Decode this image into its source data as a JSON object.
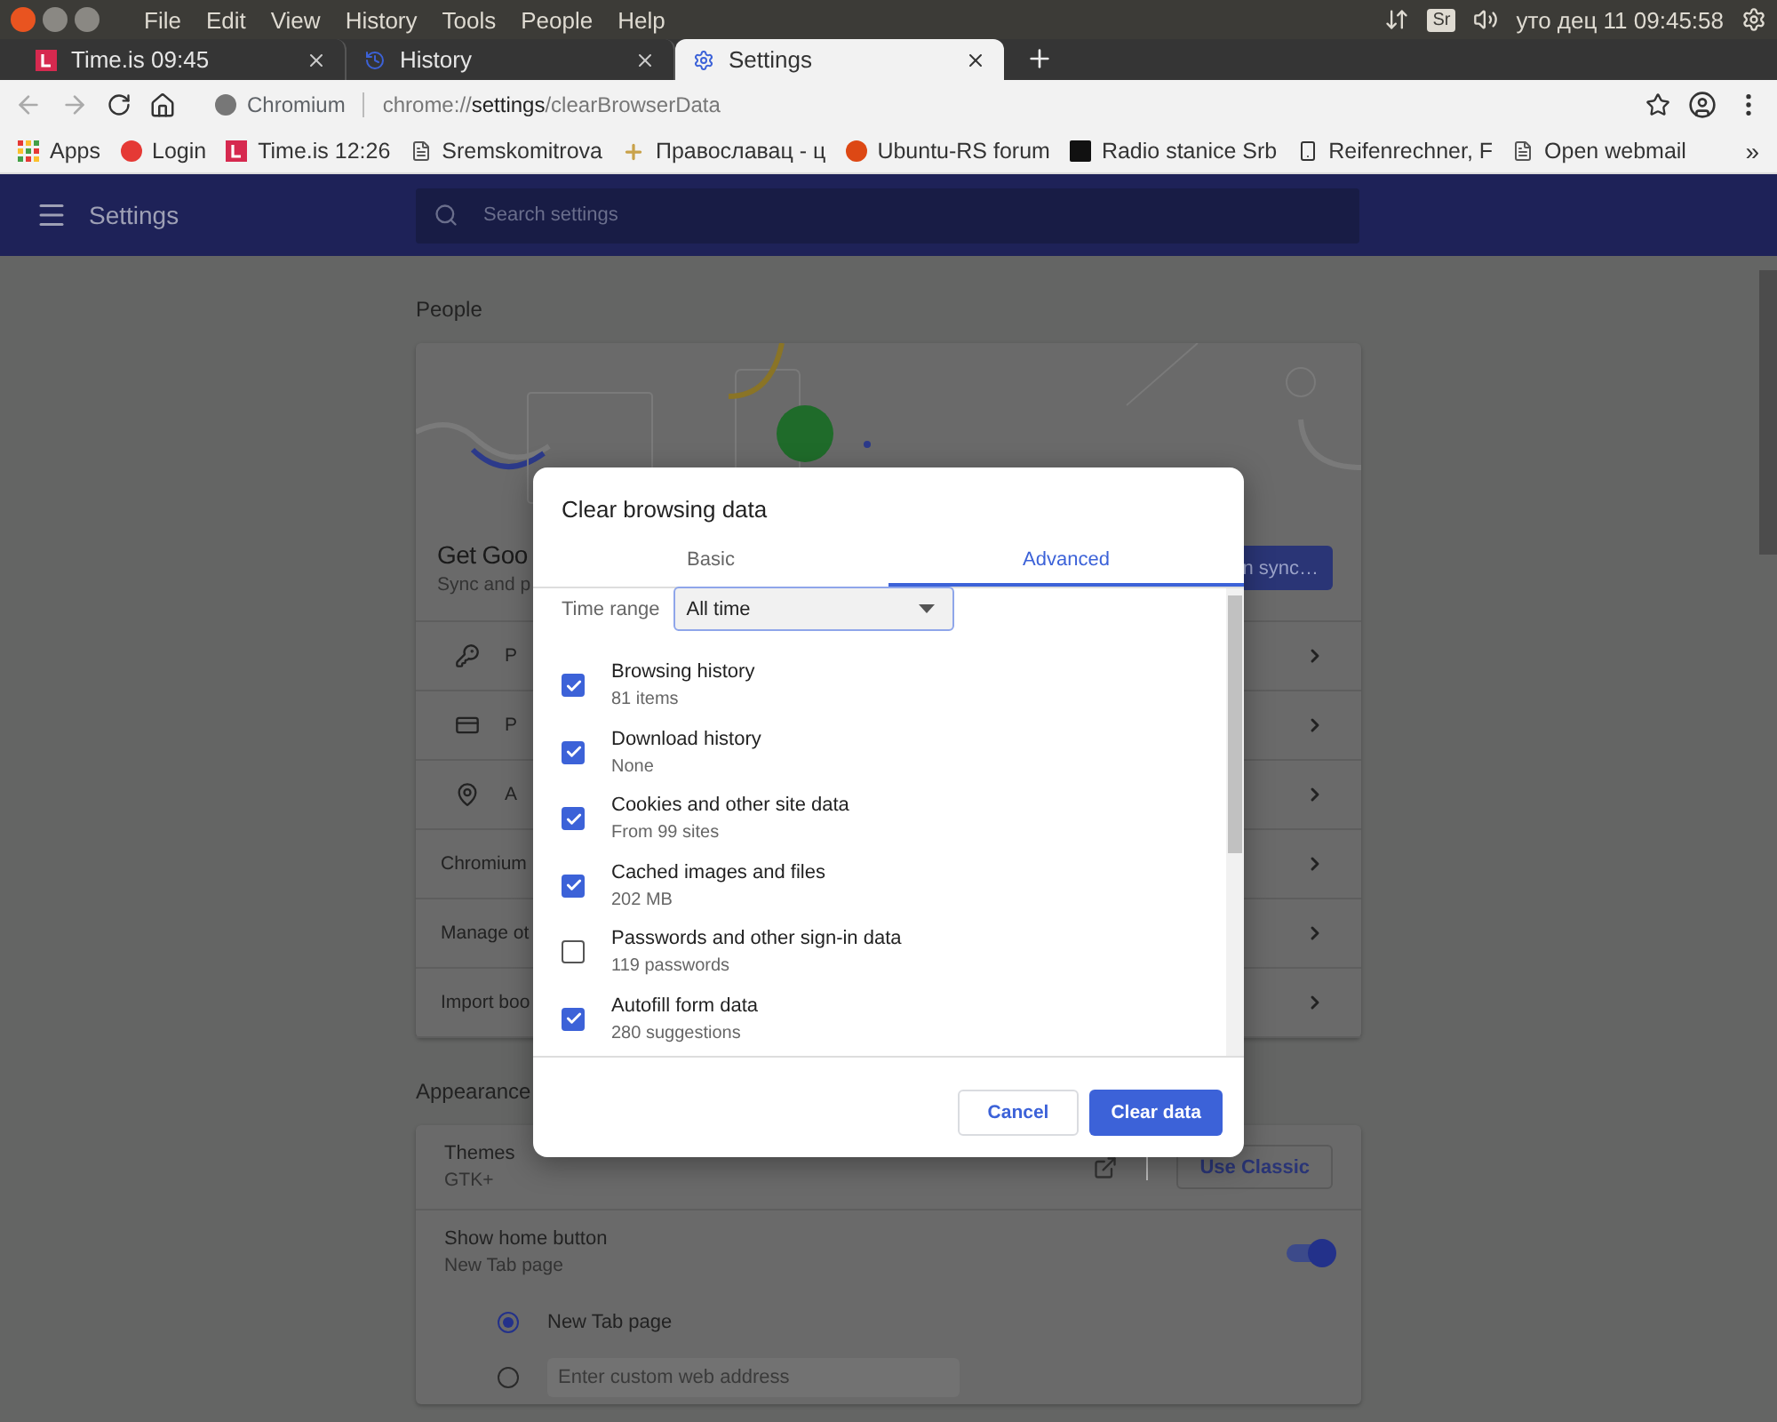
{
  "os_bar": {
    "menus": [
      "File",
      "Edit",
      "View",
      "History",
      "Tools",
      "People",
      "Help"
    ],
    "keyboard": "Sr",
    "clock": "уто дец 11 09:45:58"
  },
  "tabs": [
    {
      "title": "Time.is 09:45",
      "kind": "timeis",
      "selected": false
    },
    {
      "title": "History",
      "kind": "history",
      "selected": false
    },
    {
      "title": "Settings",
      "kind": "gear",
      "selected": true
    }
  ],
  "address": {
    "site": "Chromium",
    "scheme": "chrome://",
    "host": "settings",
    "path": "/clearBrowserData"
  },
  "bookmarks": [
    {
      "title": "Apps",
      "kind": "apps"
    },
    {
      "title": "Login",
      "kind": "login"
    },
    {
      "title": "Time.is 12:26",
      "kind": "timeis"
    },
    {
      "title": "Sremskomitrova",
      "kind": "page"
    },
    {
      "title": "Православац - ц",
      "kind": "cross"
    },
    {
      "title": "Ubuntu-RS forum",
      "kind": "ubuntu"
    },
    {
      "title": "Radio stanice Srb",
      "kind": "radio"
    },
    {
      "title": "Reifenrechner, F",
      "kind": "device"
    },
    {
      "title": "Open webmail",
      "kind": "page"
    }
  ],
  "bookmarks_overflow": "»",
  "settings_header": {
    "title": "Settings",
    "search_placeholder": "Search settings"
  },
  "people": {
    "heading": "People",
    "sign_in_title": "Get Goo",
    "sign_in_text": "Sync and p",
    "sync_button": "n sync…",
    "rows": [
      {
        "kind": "key",
        "label": "P"
      },
      {
        "kind": "card",
        "label": "P"
      },
      {
        "kind": "pin",
        "label": "A"
      },
      {
        "kind": "plain",
        "label": "Chromium"
      },
      {
        "kind": "plain",
        "label": "Manage ot"
      },
      {
        "kind": "plain",
        "label": "Import boo"
      }
    ]
  },
  "appearance": {
    "heading": "Appearance",
    "themes_label": "Themes",
    "themes_value": "GTK+",
    "theme_button": "Use Classic",
    "home_label": "Show home button",
    "home_value": "New Tab page",
    "home_on": true,
    "home_options": [
      {
        "kind": "label",
        "text": "New Tab page",
        "selected": true
      },
      {
        "kind": "input",
        "placeholder": "Enter custom web address",
        "selected": false
      }
    ]
  },
  "dialog": {
    "title": "Clear browsing data",
    "tabs": [
      {
        "label": "Basic",
        "selected": false
      },
      {
        "label": "Advanced",
        "selected": true
      }
    ],
    "time_range_label": "Time range",
    "time_range_value": "All time",
    "items": [
      {
        "label": "Browsing history",
        "detail": "81 items",
        "checked": true
      },
      {
        "label": "Download history",
        "detail": "None",
        "checked": true
      },
      {
        "label": "Cookies and other site data",
        "detail": "From 99 sites",
        "checked": true
      },
      {
        "label": "Cached images and files",
        "detail": "202 MB",
        "checked": true
      },
      {
        "label": "Passwords and other sign-in data",
        "detail": "119 passwords",
        "checked": false
      },
      {
        "label": "Autofill form data",
        "detail": "280 suggestions",
        "checked": true
      }
    ],
    "cancel": "Cancel",
    "confirm": "Clear data"
  }
}
